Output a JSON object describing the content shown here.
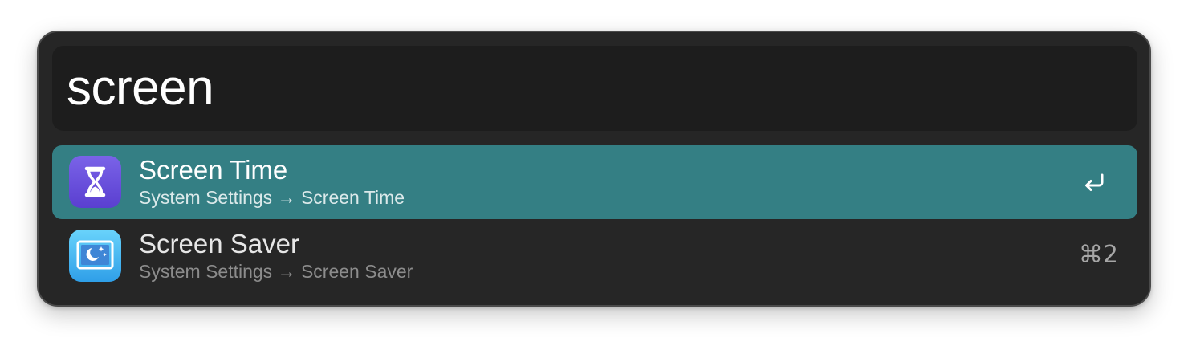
{
  "search": {
    "query": "screen"
  },
  "results": [
    {
      "title": "Screen Time",
      "subtitle": "System Settings → Screen Time",
      "icon": "hourglass-icon",
      "icon_color": "#6a4fdc",
      "selected": true,
      "action_icon": "return-key-icon"
    },
    {
      "title": "Screen Saver",
      "subtitle": "System Settings → Screen Saver",
      "icon": "screen-saver-icon",
      "icon_color": "#4ab8f2",
      "selected": false,
      "shortcut": "⌘2"
    }
  ],
  "colors": {
    "window_bg": "#262626",
    "search_bg": "#1d1d1d",
    "selection": "#347f84"
  }
}
